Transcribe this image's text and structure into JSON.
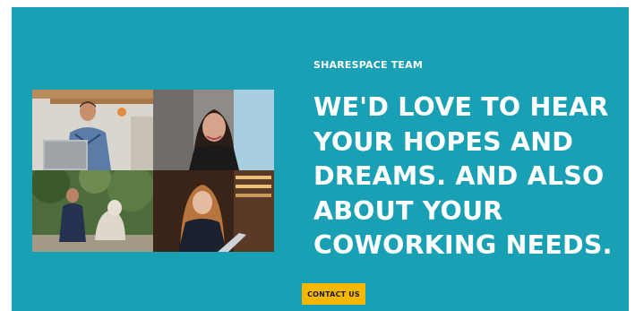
{
  "hero": {
    "eyebrow": "SHARESPACE TEAM",
    "headline": "WE'D LOVE TO HEAR YOUR HOPES AND DREAMS. AND ALSO ABOUT YOUR COWORKING NEEDS.",
    "cta_label": "CONTACT US"
  },
  "colors": {
    "background": "#19a0b4",
    "cta": "#f5b800",
    "text": "#ffffff"
  }
}
